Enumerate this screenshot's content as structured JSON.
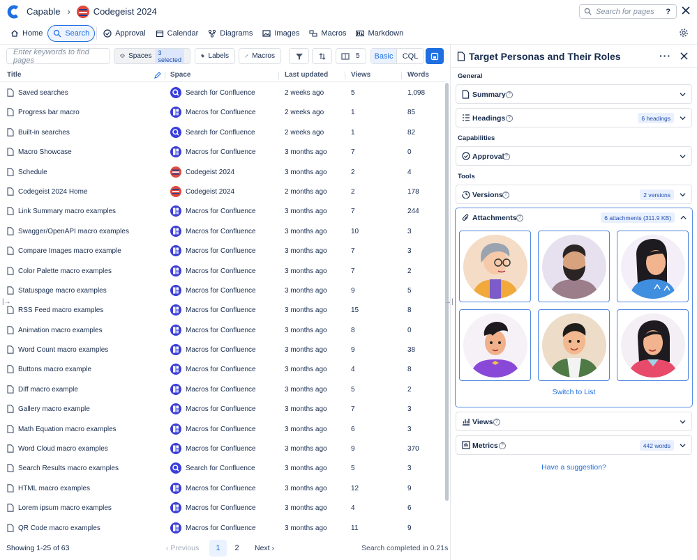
{
  "breadcrumb": {
    "app": "Capable",
    "space": "Codegeist 2024"
  },
  "top_search": {
    "placeholder": "Search for pages",
    "help": "?"
  },
  "nav": [
    {
      "label": "Home",
      "icon": "home-icon"
    },
    {
      "label": "Search",
      "icon": "search-icon",
      "active": true
    },
    {
      "label": "Approval",
      "icon": "check-circle-icon"
    },
    {
      "label": "Calendar",
      "icon": "calendar-icon"
    },
    {
      "label": "Diagrams",
      "icon": "diagram-icon"
    },
    {
      "label": "Images",
      "icon": "image-icon"
    },
    {
      "label": "Macros",
      "icon": "macro-icon"
    },
    {
      "label": "Markdown",
      "icon": "markdown-icon"
    }
  ],
  "toolbar": {
    "keyword_placeholder": "Enter keywords to find pages",
    "spaces_label": "Spaces",
    "spaces_badge": "3 selected",
    "labels_label": "Labels",
    "macros_label": "Macros",
    "columns_count": "5",
    "mode_basic": "Basic",
    "mode_cql": "CQL"
  },
  "table": {
    "columns": [
      "Title",
      "Space",
      "Last updated",
      "Views",
      "Words"
    ],
    "rows": [
      {
        "title": "Saved searches",
        "space": "Search for Confluence",
        "space_type": "search",
        "updated": "2 weeks ago",
        "views": "5",
        "words": "1,098"
      },
      {
        "title": "Progress bar macro",
        "space": "Macros for Confluence",
        "space_type": "macro",
        "updated": "2 weeks ago",
        "views": "1",
        "words": "85"
      },
      {
        "title": "Built-in searches",
        "space": "Search for Confluence",
        "space_type": "search",
        "updated": "2 weeks ago",
        "views": "1",
        "words": "82"
      },
      {
        "title": "Macro Showcase",
        "space": "Macros for Confluence",
        "space_type": "macro",
        "updated": "3 months ago",
        "views": "7",
        "words": "0"
      },
      {
        "title": "Schedule",
        "space": "Codegeist 2024",
        "space_type": "codegeist",
        "updated": "3 months ago",
        "views": "2",
        "words": "4"
      },
      {
        "title": "Codegeist 2024 Home",
        "space": "Codegeist 2024",
        "space_type": "codegeist",
        "updated": "2 months ago",
        "views": "2",
        "words": "178"
      },
      {
        "title": "Link Summary macro examples",
        "space": "Macros for Confluence",
        "space_type": "macro",
        "updated": "3 months ago",
        "views": "7",
        "words": "244"
      },
      {
        "title": "Swagger/OpenAPI macro examples",
        "space": "Macros for Confluence",
        "space_type": "macro",
        "updated": "3 months ago",
        "views": "10",
        "words": "3"
      },
      {
        "title": "Compare Images macro example",
        "space": "Macros for Confluence",
        "space_type": "macro",
        "updated": "3 months ago",
        "views": "7",
        "words": "3"
      },
      {
        "title": "Color Palette macro examples",
        "space": "Macros for Confluence",
        "space_type": "macro",
        "updated": "3 months ago",
        "views": "7",
        "words": "2"
      },
      {
        "title": "Statuspage macro examples",
        "space": "Macros for Confluence",
        "space_type": "macro",
        "updated": "3 months ago",
        "views": "9",
        "words": "5"
      },
      {
        "title": "RSS Feed macro examples",
        "space": "Macros for Confluence",
        "space_type": "macro",
        "updated": "3 months ago",
        "views": "15",
        "words": "8"
      },
      {
        "title": "Animation macro examples",
        "space": "Macros for Confluence",
        "space_type": "macro",
        "updated": "3 months ago",
        "views": "8",
        "words": "0"
      },
      {
        "title": "Word Count macro examples",
        "space": "Macros for Confluence",
        "space_type": "macro",
        "updated": "3 months ago",
        "views": "9",
        "words": "38"
      },
      {
        "title": "Buttons macro example",
        "space": "Macros for Confluence",
        "space_type": "macro",
        "updated": "3 months ago",
        "views": "4",
        "words": "8"
      },
      {
        "title": "Diff macro example",
        "space": "Macros for Confluence",
        "space_type": "macro",
        "updated": "3 months ago",
        "views": "5",
        "words": "2"
      },
      {
        "title": "Gallery macro example",
        "space": "Macros for Confluence",
        "space_type": "macro",
        "updated": "3 months ago",
        "views": "7",
        "words": "3"
      },
      {
        "title": "Math Equation macro examples",
        "space": "Macros for Confluence",
        "space_type": "macro",
        "updated": "3 months ago",
        "views": "6",
        "words": "3"
      },
      {
        "title": "Word Cloud macro examples",
        "space": "Macros for Confluence",
        "space_type": "macro",
        "updated": "3 months ago",
        "views": "9",
        "words": "370"
      },
      {
        "title": "Search Results macro examples",
        "space": "Search for Confluence",
        "space_type": "search",
        "updated": "3 months ago",
        "views": "5",
        "words": "3"
      },
      {
        "title": "HTML macro examples",
        "space": "Macros for Confluence",
        "space_type": "macro",
        "updated": "3 months ago",
        "views": "12",
        "words": "9"
      },
      {
        "title": "Lorem ipsum macro examples",
        "space": "Macros for Confluence",
        "space_type": "macro",
        "updated": "3 months ago",
        "views": "4",
        "words": "6"
      },
      {
        "title": "QR Code macro examples",
        "space": "Macros for Confluence",
        "space_type": "macro",
        "updated": "3 months ago",
        "views": "11",
        "words": "9"
      }
    ]
  },
  "footer": {
    "showing": "Showing 1-25 of 63",
    "previous": "Previous",
    "page1": "1",
    "page2": "2",
    "next": "Next",
    "status": "Search completed in 0.21s"
  },
  "panel": {
    "title": "Target Personas and Their Roles",
    "section_general": "General",
    "section_capabilities": "Capabilities",
    "section_tools": "Tools",
    "summary": "Summary",
    "headings": "Headings",
    "headings_badge": "6 headings",
    "approval": "Approval",
    "versions": "Versions",
    "versions_badge": "2 versions",
    "attachments": "Attachments",
    "attachments_badge": "6 attachments (311.9 KB)",
    "switch_to_list": "Switch to List",
    "views": "Views",
    "metrics": "Metrics",
    "metrics_badge": "442 words",
    "suggestion": "Have a suggestion?"
  },
  "colors": {
    "accent": "#1f6fe0",
    "brand": "#1f6fe0"
  }
}
